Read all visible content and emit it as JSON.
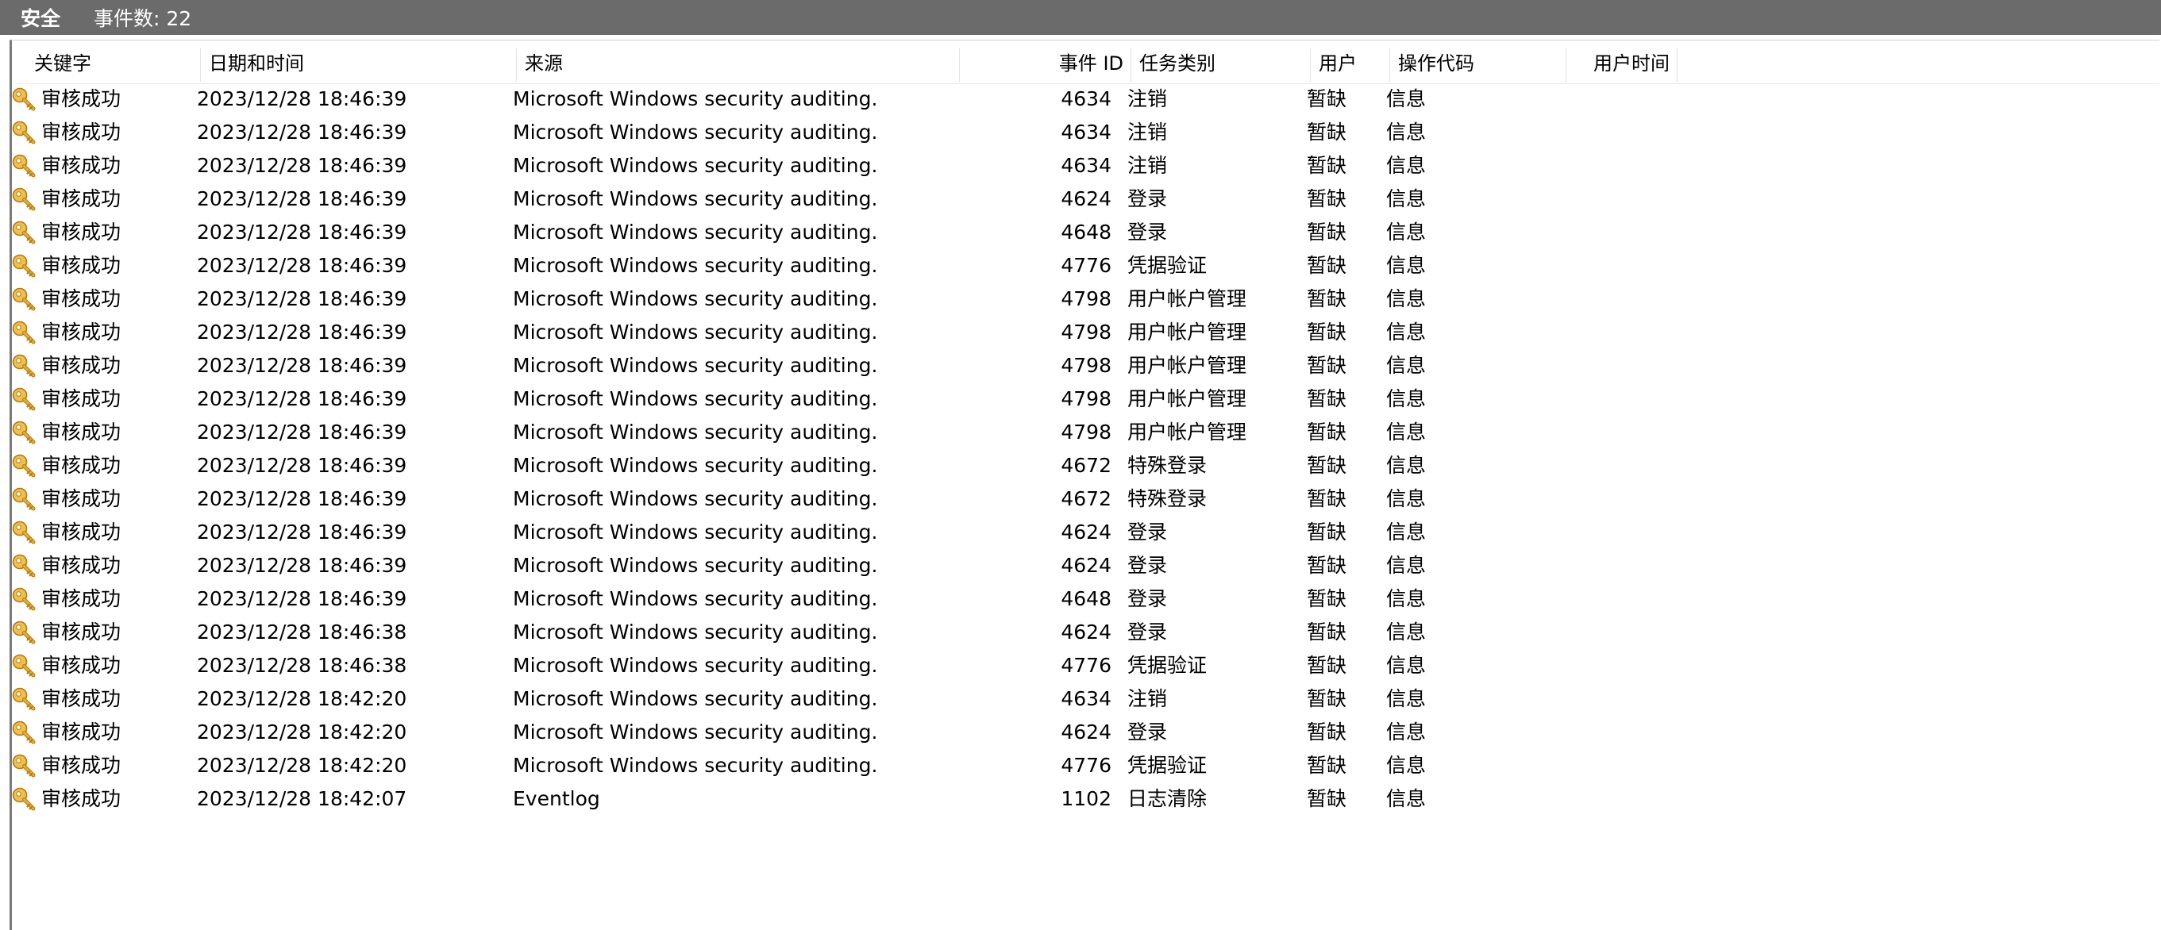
{
  "title_bar": {
    "log_name": "安全",
    "event_count_label": "事件数: 22"
  },
  "columns": [
    {
      "key": "keyword",
      "label": "关键字"
    },
    {
      "key": "datetime",
      "label": "日期和时间"
    },
    {
      "key": "source",
      "label": "来源"
    },
    {
      "key": "event_id",
      "label": "事件 ID"
    },
    {
      "key": "task_category",
      "label": "任务类别"
    },
    {
      "key": "user",
      "label": "用户"
    },
    {
      "key": "opcode",
      "label": "操作代码"
    },
    {
      "key": "user_time",
      "label": "用户时间"
    }
  ],
  "rows": [
    {
      "keyword": "审核成功",
      "datetime": "2023/12/28 18:46:39",
      "source": "Microsoft Windows security auditing.",
      "event_id": "4634",
      "task_category": "注销",
      "user": "暂缺",
      "opcode": "信息",
      "user_time": ""
    },
    {
      "keyword": "审核成功",
      "datetime": "2023/12/28 18:46:39",
      "source": "Microsoft Windows security auditing.",
      "event_id": "4634",
      "task_category": "注销",
      "user": "暂缺",
      "opcode": "信息",
      "user_time": ""
    },
    {
      "keyword": "审核成功",
      "datetime": "2023/12/28 18:46:39",
      "source": "Microsoft Windows security auditing.",
      "event_id": "4634",
      "task_category": "注销",
      "user": "暂缺",
      "opcode": "信息",
      "user_time": ""
    },
    {
      "keyword": "审核成功",
      "datetime": "2023/12/28 18:46:39",
      "source": "Microsoft Windows security auditing.",
      "event_id": "4624",
      "task_category": "登录",
      "user": "暂缺",
      "opcode": "信息",
      "user_time": ""
    },
    {
      "keyword": "审核成功",
      "datetime": "2023/12/28 18:46:39",
      "source": "Microsoft Windows security auditing.",
      "event_id": "4648",
      "task_category": "登录",
      "user": "暂缺",
      "opcode": "信息",
      "user_time": ""
    },
    {
      "keyword": "审核成功",
      "datetime": "2023/12/28 18:46:39",
      "source": "Microsoft Windows security auditing.",
      "event_id": "4776",
      "task_category": "凭据验证",
      "user": "暂缺",
      "opcode": "信息",
      "user_time": ""
    },
    {
      "keyword": "审核成功",
      "datetime": "2023/12/28 18:46:39",
      "source": "Microsoft Windows security auditing.",
      "event_id": "4798",
      "task_category": "用户帐户管理",
      "user": "暂缺",
      "opcode": "信息",
      "user_time": ""
    },
    {
      "keyword": "审核成功",
      "datetime": "2023/12/28 18:46:39",
      "source": "Microsoft Windows security auditing.",
      "event_id": "4798",
      "task_category": "用户帐户管理",
      "user": "暂缺",
      "opcode": "信息",
      "user_time": ""
    },
    {
      "keyword": "审核成功",
      "datetime": "2023/12/28 18:46:39",
      "source": "Microsoft Windows security auditing.",
      "event_id": "4798",
      "task_category": "用户帐户管理",
      "user": "暂缺",
      "opcode": "信息",
      "user_time": ""
    },
    {
      "keyword": "审核成功",
      "datetime": "2023/12/28 18:46:39",
      "source": "Microsoft Windows security auditing.",
      "event_id": "4798",
      "task_category": "用户帐户管理",
      "user": "暂缺",
      "opcode": "信息",
      "user_time": ""
    },
    {
      "keyword": "审核成功",
      "datetime": "2023/12/28 18:46:39",
      "source": "Microsoft Windows security auditing.",
      "event_id": "4798",
      "task_category": "用户帐户管理",
      "user": "暂缺",
      "opcode": "信息",
      "user_time": ""
    },
    {
      "keyword": "审核成功",
      "datetime": "2023/12/28 18:46:39",
      "source": "Microsoft Windows security auditing.",
      "event_id": "4672",
      "task_category": "特殊登录",
      "user": "暂缺",
      "opcode": "信息",
      "user_time": ""
    },
    {
      "keyword": "审核成功",
      "datetime": "2023/12/28 18:46:39",
      "source": "Microsoft Windows security auditing.",
      "event_id": "4672",
      "task_category": "特殊登录",
      "user": "暂缺",
      "opcode": "信息",
      "user_time": ""
    },
    {
      "keyword": "审核成功",
      "datetime": "2023/12/28 18:46:39",
      "source": "Microsoft Windows security auditing.",
      "event_id": "4624",
      "task_category": "登录",
      "user": "暂缺",
      "opcode": "信息",
      "user_time": ""
    },
    {
      "keyword": "审核成功",
      "datetime": "2023/12/28 18:46:39",
      "source": "Microsoft Windows security auditing.",
      "event_id": "4624",
      "task_category": "登录",
      "user": "暂缺",
      "opcode": "信息",
      "user_time": ""
    },
    {
      "keyword": "审核成功",
      "datetime": "2023/12/28 18:46:39",
      "source": "Microsoft Windows security auditing.",
      "event_id": "4648",
      "task_category": "登录",
      "user": "暂缺",
      "opcode": "信息",
      "user_time": ""
    },
    {
      "keyword": "审核成功",
      "datetime": "2023/12/28 18:46:38",
      "source": "Microsoft Windows security auditing.",
      "event_id": "4624",
      "task_category": "登录",
      "user": "暂缺",
      "opcode": "信息",
      "user_time": ""
    },
    {
      "keyword": "审核成功",
      "datetime": "2023/12/28 18:46:38",
      "source": "Microsoft Windows security auditing.",
      "event_id": "4776",
      "task_category": "凭据验证",
      "user": "暂缺",
      "opcode": "信息",
      "user_time": ""
    },
    {
      "keyword": "审核成功",
      "datetime": "2023/12/28 18:42:20",
      "source": "Microsoft Windows security auditing.",
      "event_id": "4634",
      "task_category": "注销",
      "user": "暂缺",
      "opcode": "信息",
      "user_time": ""
    },
    {
      "keyword": "审核成功",
      "datetime": "2023/12/28 18:42:20",
      "source": "Microsoft Windows security auditing.",
      "event_id": "4624",
      "task_category": "登录",
      "user": "暂缺",
      "opcode": "信息",
      "user_time": ""
    },
    {
      "keyword": "审核成功",
      "datetime": "2023/12/28 18:42:20",
      "source": "Microsoft Windows security auditing.",
      "event_id": "4776",
      "task_category": "凭据验证",
      "user": "暂缺",
      "opcode": "信息",
      "user_time": ""
    },
    {
      "keyword": "审核成功",
      "datetime": "2023/12/28 18:42:07",
      "source": "Eventlog",
      "event_id": "1102",
      "task_category": "日志清除",
      "user": "暂缺",
      "opcode": "信息",
      "user_time": ""
    }
  ],
  "icons": {
    "row_icon": "key-icon"
  },
  "colors": {
    "title_bar_bg": "#6b6b6b",
    "key_gold": "#e0a21a"
  }
}
